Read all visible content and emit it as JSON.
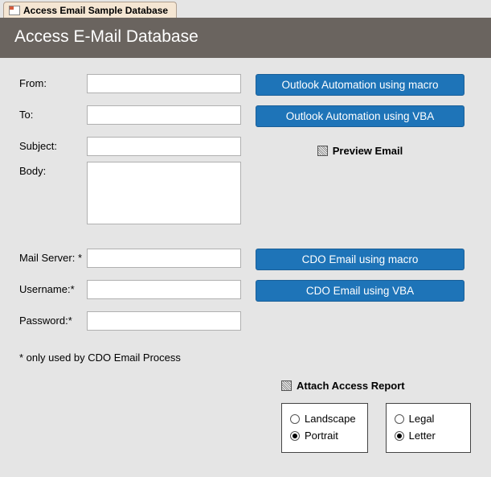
{
  "tab": {
    "title": "Access Email Sample Database"
  },
  "header": {
    "title": "Access E-Mail Database"
  },
  "fields": {
    "from": {
      "label": "From:",
      "value": ""
    },
    "to": {
      "label": "To:",
      "value": ""
    },
    "subject": {
      "label": "Subject:",
      "value": ""
    },
    "body": {
      "label": "Body:",
      "value": ""
    },
    "mailserver": {
      "label": "Mail Server: *",
      "value": ""
    },
    "username": {
      "label": "Username:*",
      "value": ""
    },
    "password": {
      "label": "Password:*",
      "value": ""
    }
  },
  "buttons": {
    "outlook_macro": "Outlook Automation using macro",
    "outlook_vba": "Outlook Automation using VBA",
    "cdo_macro": "CDO Email using macro",
    "cdo_vba": "CDO Email using VBA"
  },
  "checks": {
    "preview": "Preview Email",
    "attach": "Attach Access Report"
  },
  "note": "* only used by CDO Email Process",
  "orientation": {
    "landscape": "Landscape",
    "portrait": "Portrait",
    "selected": "portrait"
  },
  "paper": {
    "legal": "Legal",
    "letter": "Letter",
    "selected": "letter"
  }
}
